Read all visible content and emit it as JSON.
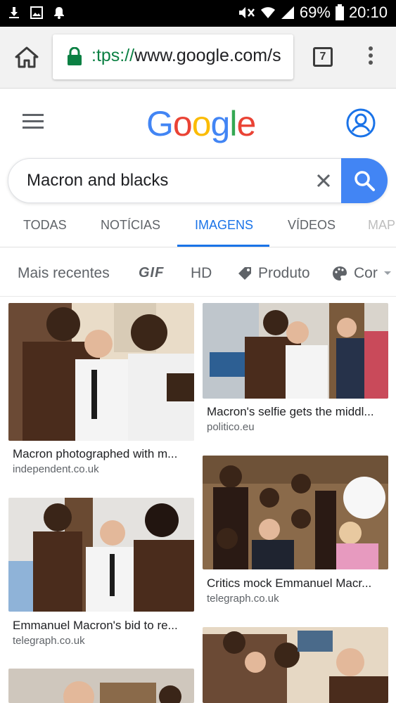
{
  "status_bar": {
    "battery": "69%",
    "time": "20:10",
    "icons_left": [
      "download-icon",
      "image-icon",
      "notification-bell-icon"
    ],
    "icons_right": [
      "mute-icon",
      "wifi-icon",
      "signal-icon",
      "battery-icon"
    ]
  },
  "browser": {
    "url_scheme": ":tps://",
    "url_host": "www.google.com/s",
    "tab_count": "7"
  },
  "search": {
    "query": "Macron and blacks"
  },
  "tabs": [
    {
      "label": "TODAS"
    },
    {
      "label": "NOTÍCIAS"
    },
    {
      "label": "IMAGENS"
    },
    {
      "label": "VÍDEOS"
    },
    {
      "label": "MAP"
    }
  ],
  "active_tab": "IMAGENS",
  "filters": [
    {
      "label": "Mais recentes"
    },
    {
      "label": "GIF"
    },
    {
      "label": "HD"
    },
    {
      "label": "Produto"
    },
    {
      "label": "Cor"
    }
  ],
  "results": [
    {
      "title": "Macron photographed with m...",
      "source": "independent.co.uk"
    },
    {
      "title": "Macron's selfie gets the middl...",
      "source": "politico.eu"
    },
    {
      "title": "Emmanuel Macron's bid to re...",
      "source": "telegraph.co.uk"
    },
    {
      "title": "Critics mock Emmanuel Macr...",
      "source": "telegraph.co.uk"
    },
    {
      "title": "",
      "source": ""
    },
    {
      "title": "",
      "source": ""
    }
  ],
  "colors": {
    "accent": "#1a73e8",
    "search_button": "#4285f4",
    "google_blue": "#4285f4",
    "google_red": "#ea4335",
    "google_yellow": "#fbbc05",
    "google_green": "#34a853"
  }
}
